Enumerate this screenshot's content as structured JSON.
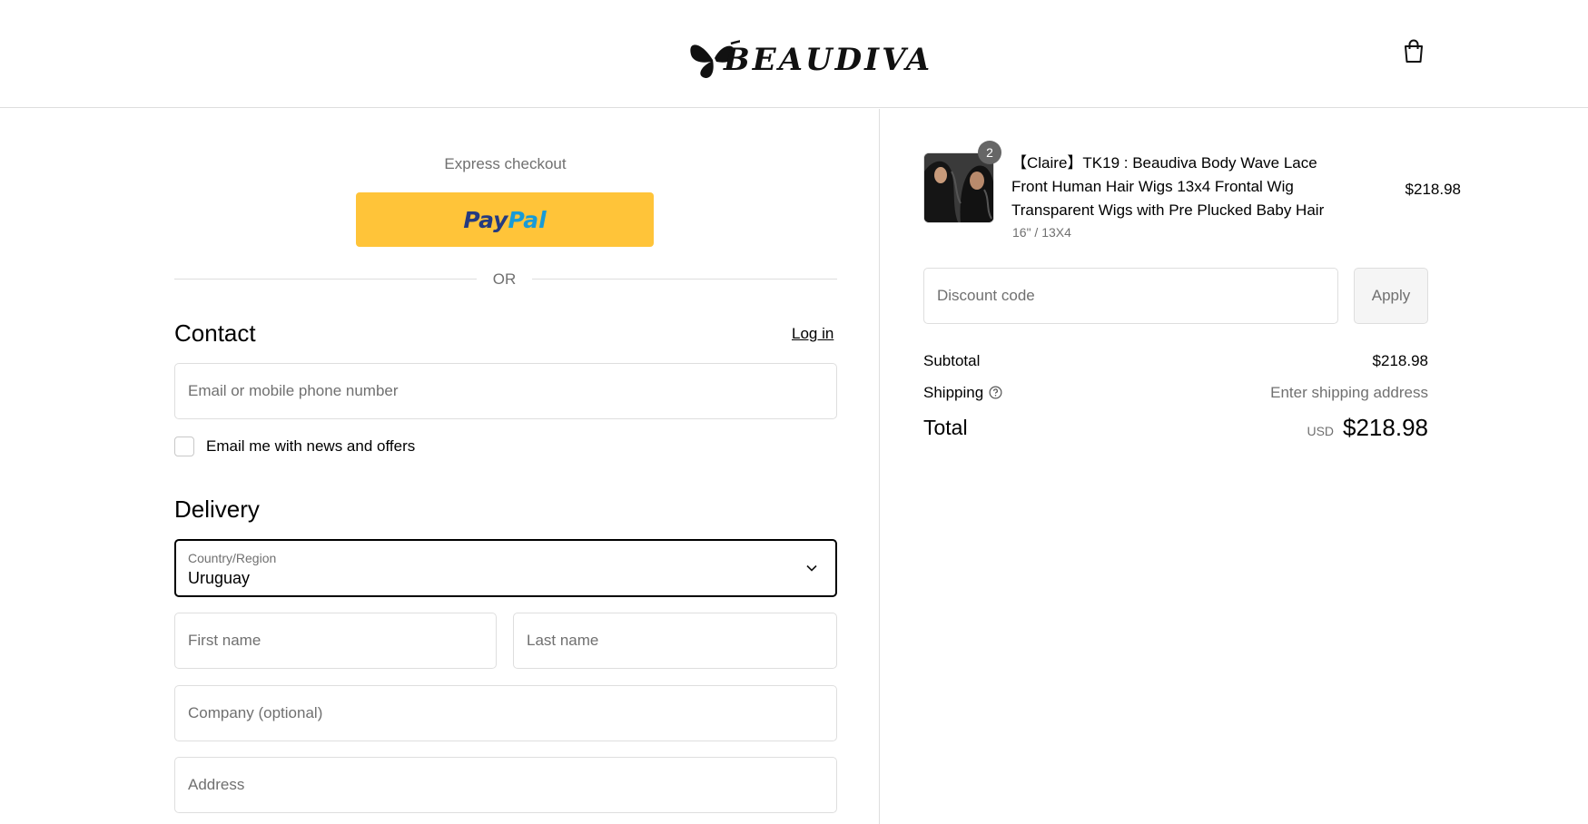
{
  "header": {
    "logo_text": "BEAUDIVA",
    "cart_icon": "shopping-bag-icon"
  },
  "express": {
    "label": "Express checkout",
    "paypal_part1": "Pay",
    "paypal_part2": "Pal",
    "or_text": "OR"
  },
  "contact": {
    "title": "Contact",
    "login_label": "Log in",
    "email_placeholder": "Email or mobile phone number",
    "news_label": "Email me with news and offers"
  },
  "delivery": {
    "title": "Delivery",
    "country_label": "Country/Region",
    "country_value": "Uruguay",
    "first_name_placeholder": "First name",
    "last_name_placeholder": "Last name",
    "company_placeholder": "Company (optional)",
    "address_placeholder": "Address"
  },
  "summary": {
    "item": {
      "quantity": "2",
      "title": "【Claire】TK19 : Beaudiva Body Wave Lace Front Human Hair Wigs 13x4 Frontal Wig Transparent Wigs with Pre Plucked Baby Hair",
      "variant": "16\" / 13X4",
      "price": "$218.98"
    },
    "discount_placeholder": "Discount code",
    "apply_label": "Apply",
    "subtotal_label": "Subtotal",
    "subtotal_value": "$218.98",
    "shipping_label": "Shipping",
    "shipping_value": "Enter shipping address",
    "total_label": "Total",
    "currency": "USD",
    "total_value": "$218.98"
  },
  "colors": {
    "paypal_yellow": "#ffc439",
    "paypal_dark_blue": "#253b80",
    "paypal_light_blue": "#179bd7",
    "border": "#dedede",
    "muted_text": "#707070"
  }
}
